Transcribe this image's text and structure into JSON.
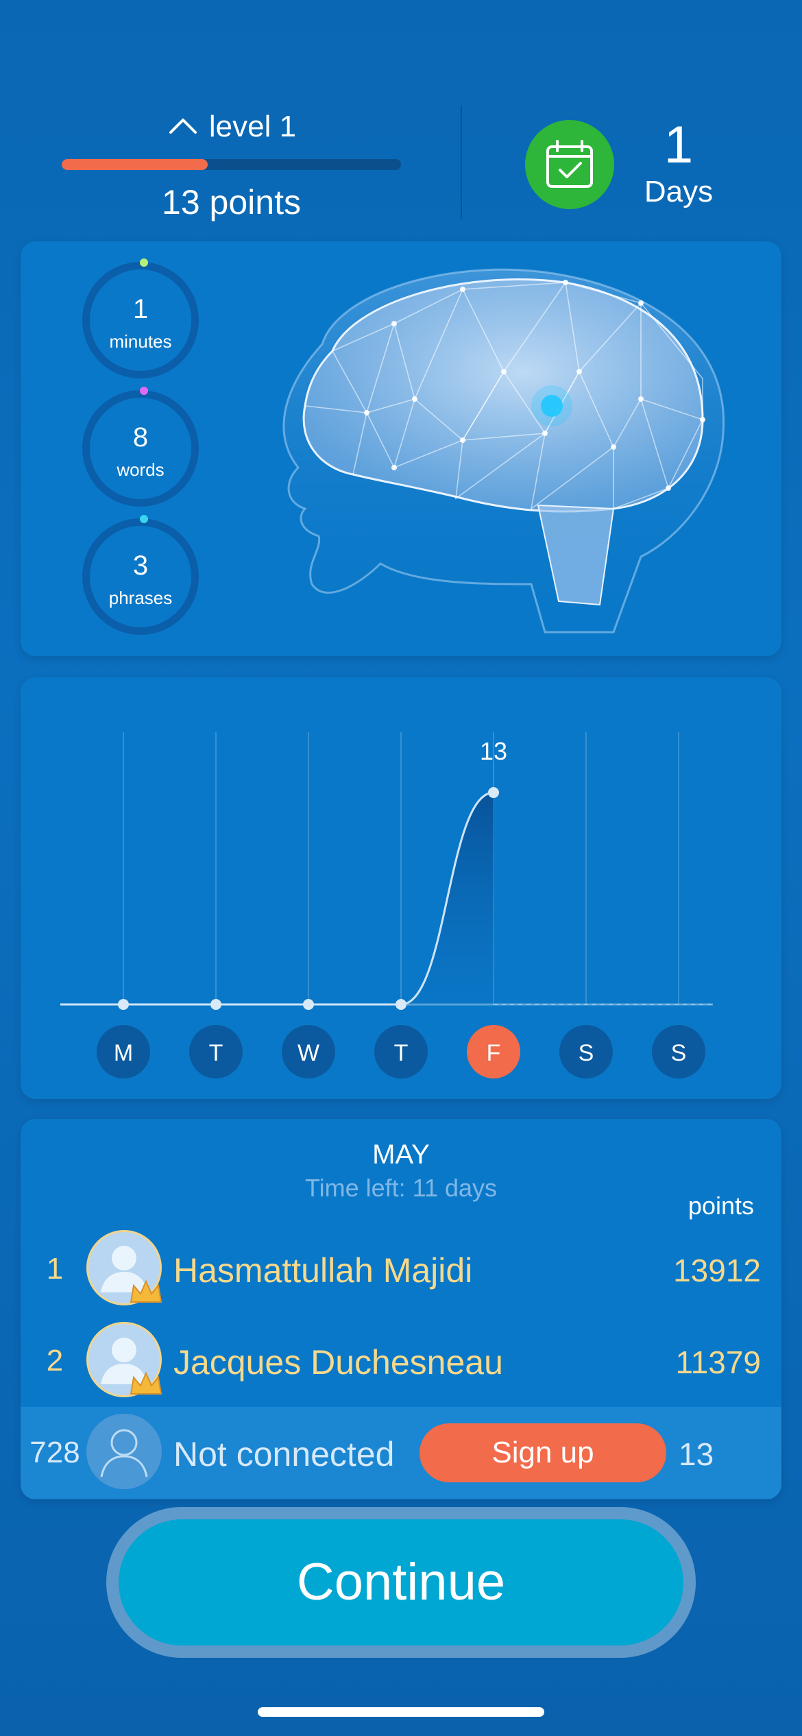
{
  "header": {
    "level_label": "level 1",
    "level_progress": 0.43,
    "points_label": "13 points",
    "streak_number": "1",
    "streak_label": "Days"
  },
  "stats": [
    {
      "value": "1",
      "label": "minutes",
      "dot_color": "#b6f07a"
    },
    {
      "value": "8",
      "label": "words",
      "dot_color": "#e06bf2"
    },
    {
      "value": "3",
      "label": "phrases",
      "dot_color": "#3ad4ee"
    }
  ],
  "weekly": {
    "days": [
      "M",
      "T",
      "W",
      "T",
      "F",
      "S",
      "S"
    ],
    "current_day_index": 4,
    "peak_label": "13"
  },
  "chart_data": {
    "type": "area",
    "categories": [
      "M",
      "T",
      "W",
      "T",
      "F",
      "S",
      "S"
    ],
    "values": [
      0,
      0,
      0,
      0,
      13,
      null,
      null
    ],
    "ylim": [
      0,
      13
    ],
    "data_labels": {
      "F": "13"
    }
  },
  "leaderboard": {
    "month": "MAY",
    "time_left": "Time left: 11 days",
    "points_header": "points",
    "rows": [
      {
        "rank": "1",
        "name": "Hasmattullah Majidi",
        "points": "13912"
      },
      {
        "rank": "2",
        "name": "Jacques Duchesneau",
        "points": "11379"
      }
    ],
    "me": {
      "rank": "728",
      "name": "Not connected",
      "signup_label": "Sign up",
      "points": "13"
    }
  },
  "continue_label": "Continue",
  "colors": {
    "accent_orange": "#f26b4a",
    "success_green": "#2db63a",
    "background_blue": "#0a6cbb",
    "continue_cyan": "#00a7d2",
    "gold_text": "#f6d98c"
  }
}
